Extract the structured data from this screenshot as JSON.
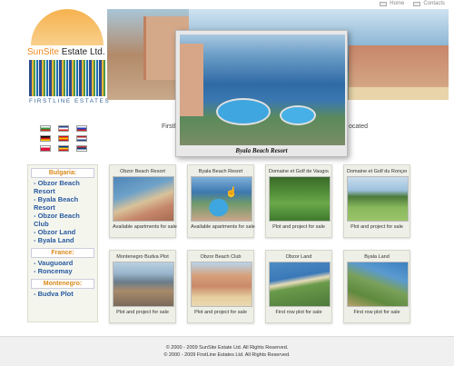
{
  "top_links": {
    "home": "Home",
    "contacts": "Contacts"
  },
  "logo": {
    "name_part1": "SunSite",
    "name_part2": " Estate Ltd.",
    "tagline": "FIRSTLINE ESTATES"
  },
  "popup": {
    "caption": "Byala Beach Resort"
  },
  "hidden_text": {
    "left": "Firstl",
    "right": "ocated"
  },
  "flags": [
    {
      "name": "bulgaria-flag",
      "colors": [
        "#ffffff",
        "#2e9b46",
        "#d62612"
      ]
    },
    {
      "name": "uk-flag",
      "colors": [
        "#1f3f8f",
        "#ffffff",
        "#d62020"
      ]
    },
    {
      "name": "russia-flag",
      "colors": [
        "#ffffff",
        "#1f3fbf",
        "#d62020"
      ]
    },
    {
      "name": "germany-flag",
      "colors": [
        "#000000",
        "#d62020",
        "#ffce00"
      ]
    },
    {
      "name": "spain-flag",
      "colors": [
        "#c60b1e",
        "#ffc400",
        "#c60b1e"
      ]
    },
    {
      "name": "netherlands-flag",
      "colors": [
        "#ae1c28",
        "#ffffff",
        "#21468b"
      ]
    },
    {
      "name": "poland-flag",
      "colors": [
        "#ffffff",
        "#dc143c",
        "#dc143c"
      ]
    },
    {
      "name": "romania-flag",
      "colors": [
        "#002b7f",
        "#fcd116",
        "#ce1126"
      ]
    },
    {
      "name": "serbia-flag",
      "colors": [
        "#c6363c",
        "#0c4076",
        "#ffffff"
      ]
    }
  ],
  "sidebar": {
    "bulgaria": {
      "title": "Bulgaria:",
      "items": [
        "Obzor Beach Resort",
        "Byala Beach Resort",
        "Obzor Beach Club",
        "Obzor Land",
        "Byala Land"
      ]
    },
    "france": {
      "title": "France:",
      "items": [
        "Vauguoard",
        "Roncemay"
      ]
    },
    "montenegro": {
      "title": "Montenegro:",
      "items": [
        "Budva Plot"
      ]
    }
  },
  "cards": [
    {
      "title": "Obzor Beach Resort",
      "desc": "Available apartments for sale"
    },
    {
      "title": "Byala Beach Resort",
      "desc": "Available apartments for sale"
    },
    {
      "title": "Domaine et Golf de Vaugouard",
      "desc": "Plot and project for sale"
    },
    {
      "title": "Domaine et Golf du Ronçemay",
      "desc": "Plot and project for sale"
    },
    {
      "title": "Montenegro Budva Plot",
      "desc": "Plot and project for sale"
    },
    {
      "title": "Obzor Beach Club",
      "desc": "Plot and project for sale"
    },
    {
      "title": "Obzor Land",
      "desc": "First row plot for sale"
    },
    {
      "title": "Byala Land",
      "desc": "First row plot for sale"
    }
  ],
  "footer": {
    "line1": "© 2000 - 2009 SunSite Estate Ltd.  All Rights Reserved.",
    "line2": "© 2000 - 2009 FirstLine Estates Ltd.  All Rights Reserved."
  }
}
